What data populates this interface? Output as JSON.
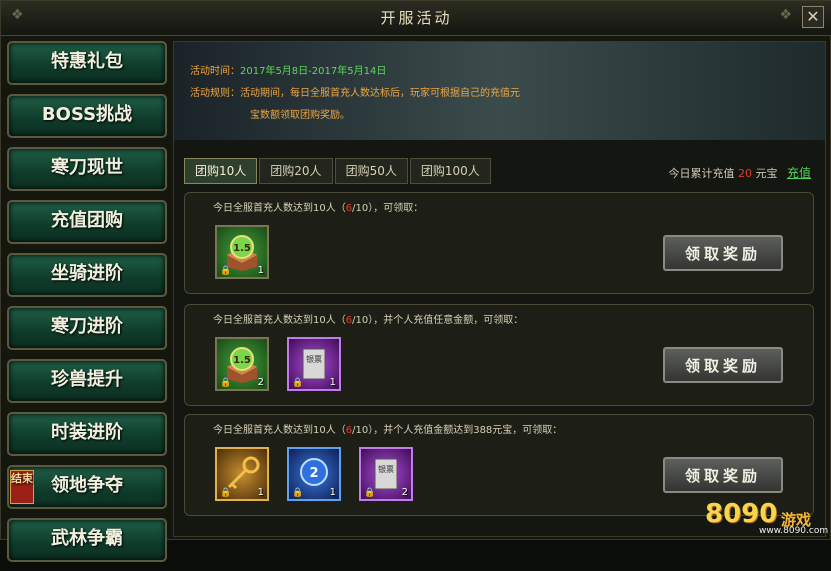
{
  "window": {
    "title": "开服活动",
    "close_glyph": "✕"
  },
  "sidebar": {
    "items": [
      {
        "label": "特惠礼包"
      },
      {
        "label": "BOSS挑战"
      },
      {
        "label": "寒刀现世"
      },
      {
        "label": "充值团购"
      },
      {
        "label": "坐骑进阶"
      },
      {
        "label": "寒刀进阶"
      },
      {
        "label": "珍兽提升"
      },
      {
        "label": "时装进阶"
      },
      {
        "label": "领地争夺",
        "badge": "结束"
      },
      {
        "label": "武林争霸"
      }
    ]
  },
  "info": {
    "time_label": "活动时间：",
    "time_value": "2017年5月8日-2017年5月14日",
    "rule_label": "活动规则：",
    "rule_line1": "活动期间，每日全服首充人数达标后，玩家可根据自己的充值元",
    "rule_line2": "宝数额领取团购奖励。"
  },
  "tabs": [
    "团购10人",
    "团购20人",
    "团购50人",
    "团购100人"
  ],
  "recharge": {
    "prefix": "今日累计充值",
    "amount": "20",
    "suffix": "元宝",
    "link": "充值"
  },
  "rows": [
    {
      "pre": "今日全服首充人数达到10人（",
      "progress": "6",
      "post": "/10），可领取：",
      "button": "领取奖励",
      "items": [
        {
          "icon": "exp-chest-icon",
          "badge": "1.5",
          "count": "1"
        }
      ]
    },
    {
      "pre": "今日全服首充人数达到10人（",
      "progress": "6",
      "post": "/10），并个人充值任意金额，可领取：",
      "button": "领取奖励",
      "items": [
        {
          "icon": "exp-chest-icon",
          "badge": "1.5",
          "count": "2"
        },
        {
          "icon": "silver-ticket-icon",
          "badge": "银票",
          "count": "1"
        }
      ]
    },
    {
      "pre": "今日全服首充人数达到10人（",
      "progress": "6",
      "post": "/10），并个人充值金额达到388元宝，可领取：",
      "button": "领取奖励",
      "items": [
        {
          "icon": "golden-key-icon",
          "badge": "",
          "count": "1"
        },
        {
          "icon": "blue-orb-icon",
          "badge": "2",
          "count": "1"
        },
        {
          "icon": "silver-ticket-icon",
          "badge": "银票",
          "count": "2"
        }
      ]
    }
  ],
  "watermark": {
    "digits": "8090",
    "brand": "游戏",
    "url": "www.8090.com"
  },
  "colors": {
    "highlight_red": "#e33b2d",
    "date_green": "#5fd75a",
    "label_orange": "#f0a640"
  }
}
